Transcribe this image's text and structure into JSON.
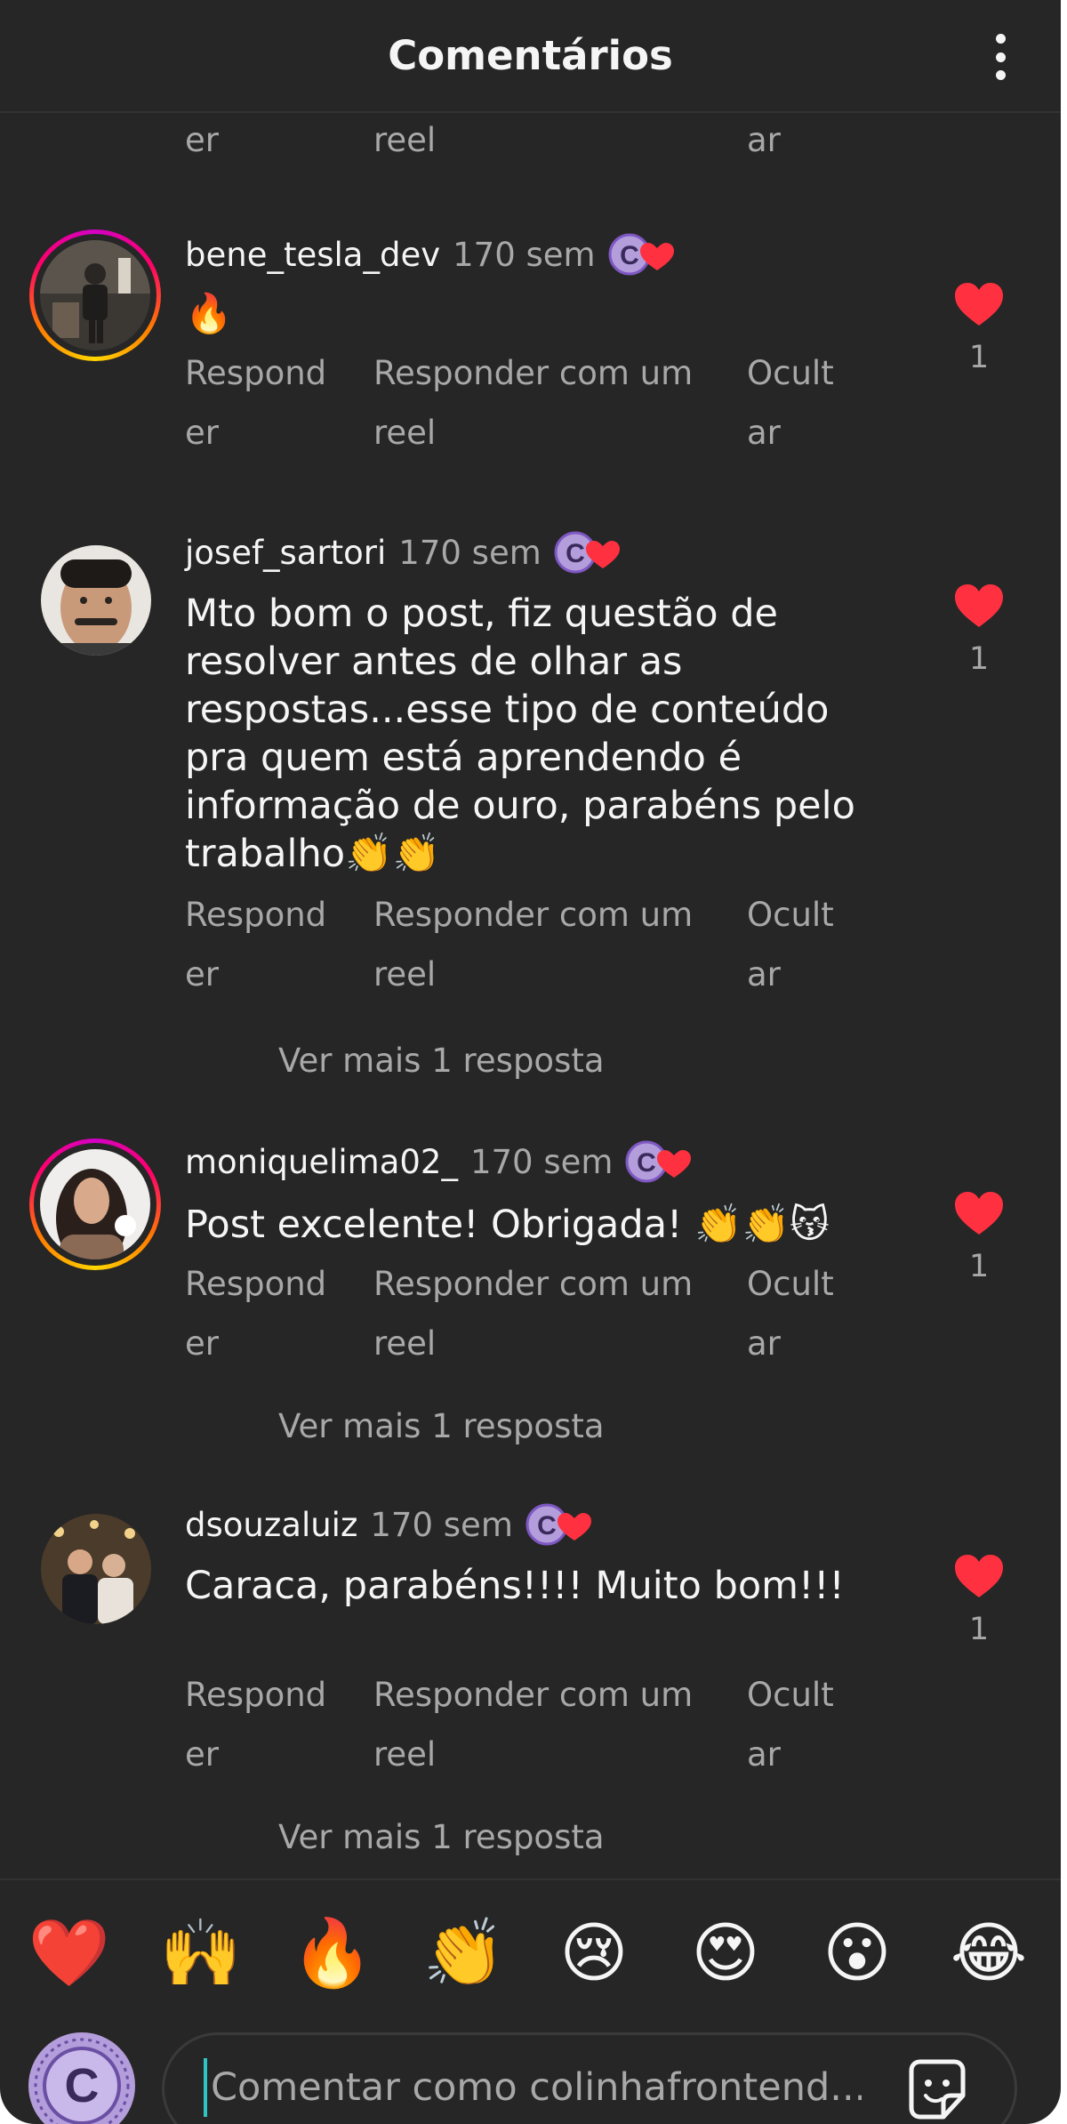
{
  "header": {
    "title": "Comentários",
    "more_icon": "more-vertical-icon"
  },
  "top_partial_actions": {
    "reply": "er",
    "reply_reel": "reel",
    "hide": "ar"
  },
  "actions": {
    "reply": "Respond\ner",
    "reply_reel": "Responder com um\nreel",
    "hide": "Ocult\nar"
  },
  "comments": [
    {
      "username": "bene_tesla_dev",
      "time": "170 sem",
      "text": "🔥",
      "likes": "1",
      "more_replies": ""
    },
    {
      "username": "josef_sartori",
      "time": "170 sem",
      "text": "Mto bom o post,  fiz questão de resolver antes de olhar as respostas...esse tipo de conteúdo pra quem está aprendendo é informação de ouro,  parabéns pelo trabalho👏👏",
      "likes": "1",
      "more_replies": "Ver mais 1 resposta"
    },
    {
      "username": "moniquelima02_",
      "time": "170 sem",
      "text": "Post excelente!  Obrigada!  👏👏😽",
      "likes": "1",
      "more_replies": "Ver mais 1 resposta"
    },
    {
      "username": "dsouzaluiz",
      "time": "170 sem",
      "text": "Caraca,  parabéns!!!! Muito bom!!!",
      "likes": "1",
      "more_replies": "Ver mais 1 resposta"
    }
  ],
  "reactions": [
    "❤️",
    "🙌",
    "🔥",
    "👏",
    "😢",
    "😍",
    "😮",
    "😂"
  ],
  "composer": {
    "placeholder": "Comentar como colinhafrontend...",
    "value": ""
  },
  "colors": {
    "background": "#262626",
    "text": "#f5f5f5",
    "secondary": "#a8a8a8",
    "like": "#ff3040",
    "creator_badge": "#b39ddb"
  }
}
